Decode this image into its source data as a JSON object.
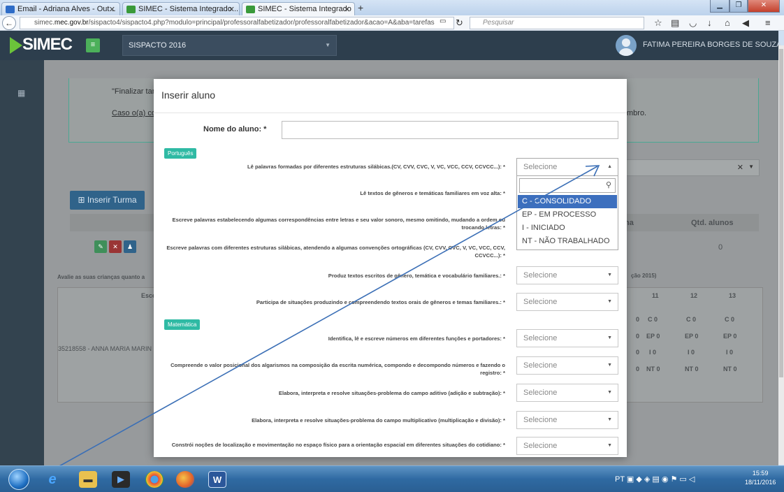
{
  "browser": {
    "tabs": [
      {
        "label": "Email - Adriana Alves - Out...",
        "icon_color": "#2e6cc7"
      },
      {
        "label": "SIMEC - Sistema Integrado ...",
        "icon_color": "#3a9a3a"
      },
      {
        "label": "SIMEC - Sistema Integrado ...",
        "icon_color": "#3a9a3a"
      }
    ],
    "url_prefix": "simec.",
    "url_domain": "mec.gov.br",
    "url_suffix": "/sispacto4/sispacto4.php?modulo=principal/professoralfabetizador/professoralfabetizador&acao=A&aba=tarefas",
    "search_placeholder": "Pesquisar"
  },
  "app": {
    "logo": "SIMEC",
    "program_select": "SISPACTO 2016",
    "user_name": "FATIMA PEREIRA BORGES DE SOUZA"
  },
  "background": {
    "text1": "\"Finalizar tare",
    "link1": "Caso o(a) coo",
    "text_right": "mbro.",
    "insert_class_button": "Inserir Turma",
    "col_na": "na",
    "col_qtd": "Qtd. alunos",
    "qtd_value": "0",
    "eval_text": "Avalie as suas crianças quanto a",
    "eval_text_right": "ção 2015)",
    "school_header": "Escol",
    "school_row": "35218558 - ANNA MARIA MARIN",
    "col_headers": [
      "11",
      "12",
      "13"
    ],
    "grid_rows": [
      [
        "C 0",
        "C 0",
        "C 0"
      ],
      [
        "EP 0",
        "EP 0",
        "EP 0"
      ],
      [
        "I 0",
        "I 0",
        "I 0"
      ],
      [
        "NT 0",
        "NT 0",
        "NT 0"
      ]
    ],
    "left_zeros": [
      "0",
      "0",
      "0",
      "0"
    ]
  },
  "modal": {
    "title": "Inserir aluno",
    "name_label": "Nome do aluno: *",
    "section_portugues": "Português",
    "section_matematica": "Matemática",
    "select_placeholder": "Selecione",
    "questions_portugues": [
      "Lê palavras formadas por diferentes estruturas silábicas.(CV, CVV, CVC, V, VC, VCC, CCV, CCVCC...): *",
      "Lê textos de gêneros e temáticas familiares em voz alta: *",
      "Escreve palavras estabelecendo algumas correspondências entre letras e seu valor sonoro, mesmo omitindo, mudando a ordem ou trocando letras: *",
      "Escreve palavras com diferentes estruturas silábicas, atendendo a algumas convenções ortográficas (CV, CVV, CVC, V, VC, VCC, CCV, CCVCC...): *",
      "Produz textos escritos de gênero, temática e vocabulário familiares.: *",
      "Participa de situações produzindo e compreendendo textos orais de gêneros e temas familiares.: *"
    ],
    "questions_matematica": [
      "Identifica, lê e escreve números em diferentes funções e portadores: *",
      "Compreende o valor posicional dos algarismos na composição da escrita numérica, compondo e decompondo números e fazendo o registro: *",
      "Elabora, interpreta e resolve situações-problema do campo aditivo (adição e subtração): *",
      "Elabora, interpreta e resolve situações-problema do campo multiplicativo (multiplicação e divisão): *",
      "Constrói noções de localização e movimentação no espaço físico para a orientação espacial em diferentes situações do cotidiano: *"
    ]
  },
  "dropdown": {
    "options": [
      "C - CONSOLIDADO",
      "EP - EM PROCESSO",
      "I - INICIADO",
      "NT - NÃO TRABALHADO"
    ],
    "highlighted_index": 0,
    "highlight_color": "#3c6fbe"
  },
  "taskbar": {
    "language": "PT",
    "time": "15:59",
    "date": "18/11/2016"
  }
}
